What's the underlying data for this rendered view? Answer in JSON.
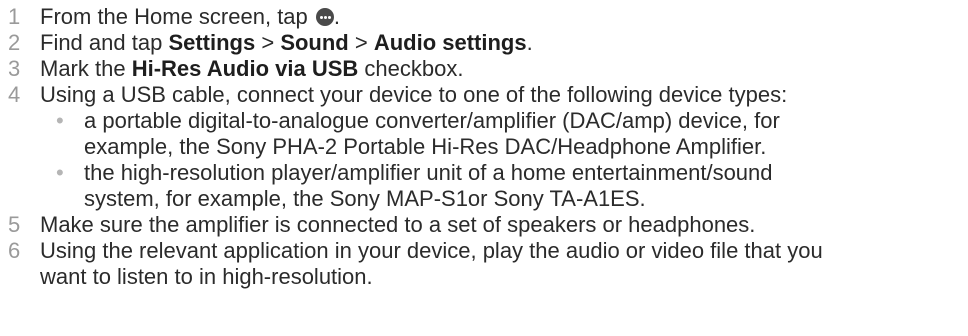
{
  "steps": [
    {
      "num": "1",
      "before": "From the Home screen, tap",
      "after": "."
    },
    {
      "num": "2",
      "prefix": "Find and tap",
      "settings": "Settings",
      "sep1": " > ",
      "sound": "Sound",
      "sep2": " > ",
      "audio": "Audio settings",
      "suffix": "."
    },
    {
      "num": "3",
      "prefix": "Mark the",
      "bold": "Hi-Res Audio via USB",
      "suffix": "checkbox."
    },
    {
      "num": "4",
      "text": "Using a USB cable, connect your device to one of the following device types:"
    },
    {
      "num": "5",
      "text": "Make sure the amplifier is connected to a set of speakers or headphones."
    },
    {
      "num": "6",
      "line1": "Using the relevant application in your device, play the audio or video file that you",
      "line2": "want to listen to in high-resolution."
    }
  ],
  "bullets": [
    {
      "marker": "•",
      "line1": "a portable digital-to-analogue converter/amplifier (DAC/amp) device, for",
      "line2": "example, the Sony PHA-2 Portable Hi-Res DAC/Headphone Amplifier."
    },
    {
      "marker": "•",
      "line1": "the high-resolution player/amplifier unit of a home entertainment/sound",
      "line2": "system, for example, the Sony MAP-S1or Sony TA-A1ES."
    }
  ],
  "icons": {
    "apps": "apps-icon"
  }
}
